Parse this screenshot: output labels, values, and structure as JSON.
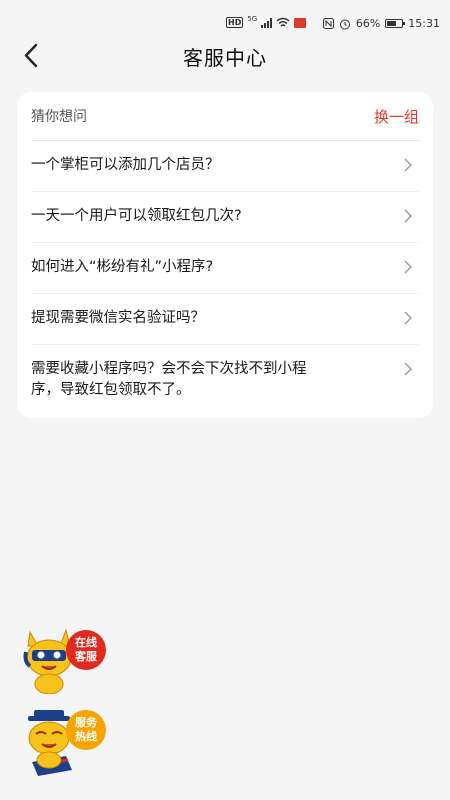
{
  "status_bar": {
    "network": "5G",
    "hd": "HD",
    "battery_percent": "66%",
    "battery_level": 0.66,
    "time": "15:31"
  },
  "header": {
    "title": "客服中心"
  },
  "faq": {
    "title": "猜你想问",
    "refresh_label": "换一组",
    "items": [
      {
        "text": "一个掌柜可以添加几个店员？"
      },
      {
        "text": "一天一个用户可以领取红包几次?"
      },
      {
        "text": "如何进入“彬纷有礼”小程序?"
      },
      {
        "text": "提现需要微信实名验证吗？"
      },
      {
        "text": "需要收藏小程序吗？会不会下次找不到小程序，导致红包领取不了。"
      }
    ]
  },
  "floating": {
    "online_service": {
      "line1": "在线",
      "line2": "客服"
    },
    "hotline": {
      "line1": "服务",
      "line2": "热线"
    }
  },
  "colors": {
    "accent": "#e53a2b",
    "background": "#f5f5f5",
    "hotline": "#f5a400"
  }
}
